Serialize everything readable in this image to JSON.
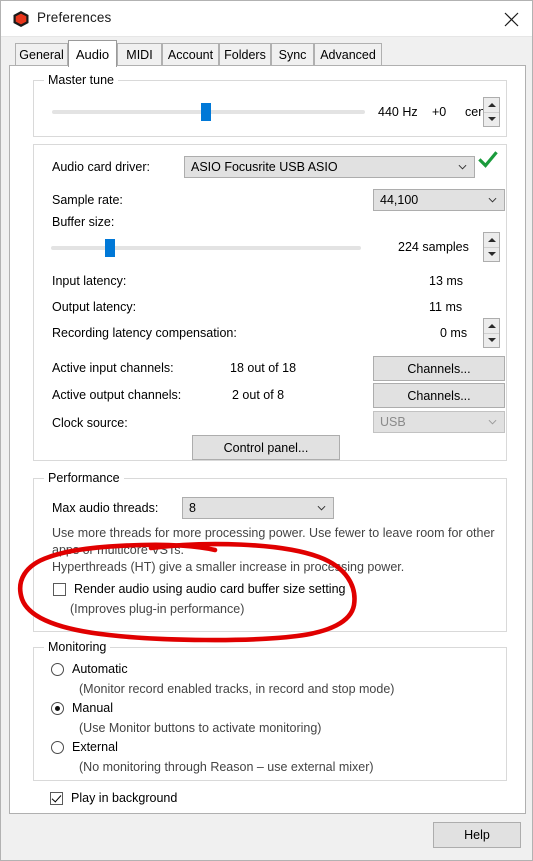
{
  "window": {
    "title": "Preferences",
    "icon": "reason-app-icon",
    "close_label": "×"
  },
  "tabs": [
    {
      "label": "General",
      "selected": false
    },
    {
      "label": "Audio",
      "selected": true
    },
    {
      "label": "MIDI",
      "selected": false
    },
    {
      "label": "Account",
      "selected": false
    },
    {
      "label": "Folders",
      "selected": false
    },
    {
      "label": "Sync",
      "selected": false
    },
    {
      "label": "Advanced",
      "selected": false
    }
  ],
  "master_tune": {
    "group_title": "Master tune",
    "frequency": "440 Hz",
    "offset": "+0",
    "unit": "cents",
    "slider_percent": 50
  },
  "audio_card": {
    "driver_label": "Audio card driver:",
    "driver_value": "ASIO Focusrite USB ASIO",
    "driver_ok_icon": "green-check-icon",
    "sample_rate_label": "Sample rate:",
    "sample_rate_value": "44,100",
    "buffer_size_label": "Buffer size:",
    "buffer_size_value": "224 samples",
    "buffer_slider_percent": 18,
    "input_latency_label": "Input latency:",
    "input_latency_value": "13 ms",
    "output_latency_label": "Output latency:",
    "output_latency_value": "11 ms",
    "rec_latency_label": "Recording latency compensation:",
    "rec_latency_value": "0 ms",
    "active_input_label": "Active input channels:",
    "active_input_value": "18 out of 18",
    "input_channels_button": "Channels...",
    "active_output_label": "Active output channels:",
    "active_output_value": "2 out of 8",
    "output_channels_button": "Channels...",
    "clock_source_label": "Clock source:",
    "clock_source_value": "USB",
    "control_panel_button": "Control panel..."
  },
  "performance": {
    "group_title": "Performance",
    "max_threads_label": "Max audio threads:",
    "max_threads_value": "8",
    "description_line1": "Use more threads for more processing power. Use fewer to leave room for other",
    "description_line2": "apps or multicore VSTs.",
    "description_line3": "Hyperthreads (HT) give a smaller increase in processing power.",
    "render_checkbox_label": "Render audio using audio card buffer size setting",
    "render_checkbox_checked": false,
    "render_sub_label": "(Improves plug-in performance)"
  },
  "monitoring": {
    "group_title": "Monitoring",
    "options": [
      {
        "label": "Automatic",
        "sub": "(Monitor record enabled tracks, in record and stop mode)",
        "selected": false
      },
      {
        "label": "Manual",
        "sub": "(Use Monitor buttons to activate monitoring)",
        "selected": true
      },
      {
        "label": "External",
        "sub": "(No monitoring through Reason – use external mixer)",
        "selected": false
      }
    ]
  },
  "play_in_background": {
    "label": "Play in background",
    "checked": true
  },
  "footer": {
    "help_label": "Help"
  },
  "annotation": {
    "shape": "red-ellipse-highlight",
    "color": "#e00000",
    "target": "render-audio-checkbox-row"
  },
  "colors": {
    "accent": "#0078d7",
    "ok_check": "#1a9b3c",
    "annotation_red": "#e00000",
    "window_bg": "#f0f0f0",
    "page_bg": "#ffffff"
  }
}
